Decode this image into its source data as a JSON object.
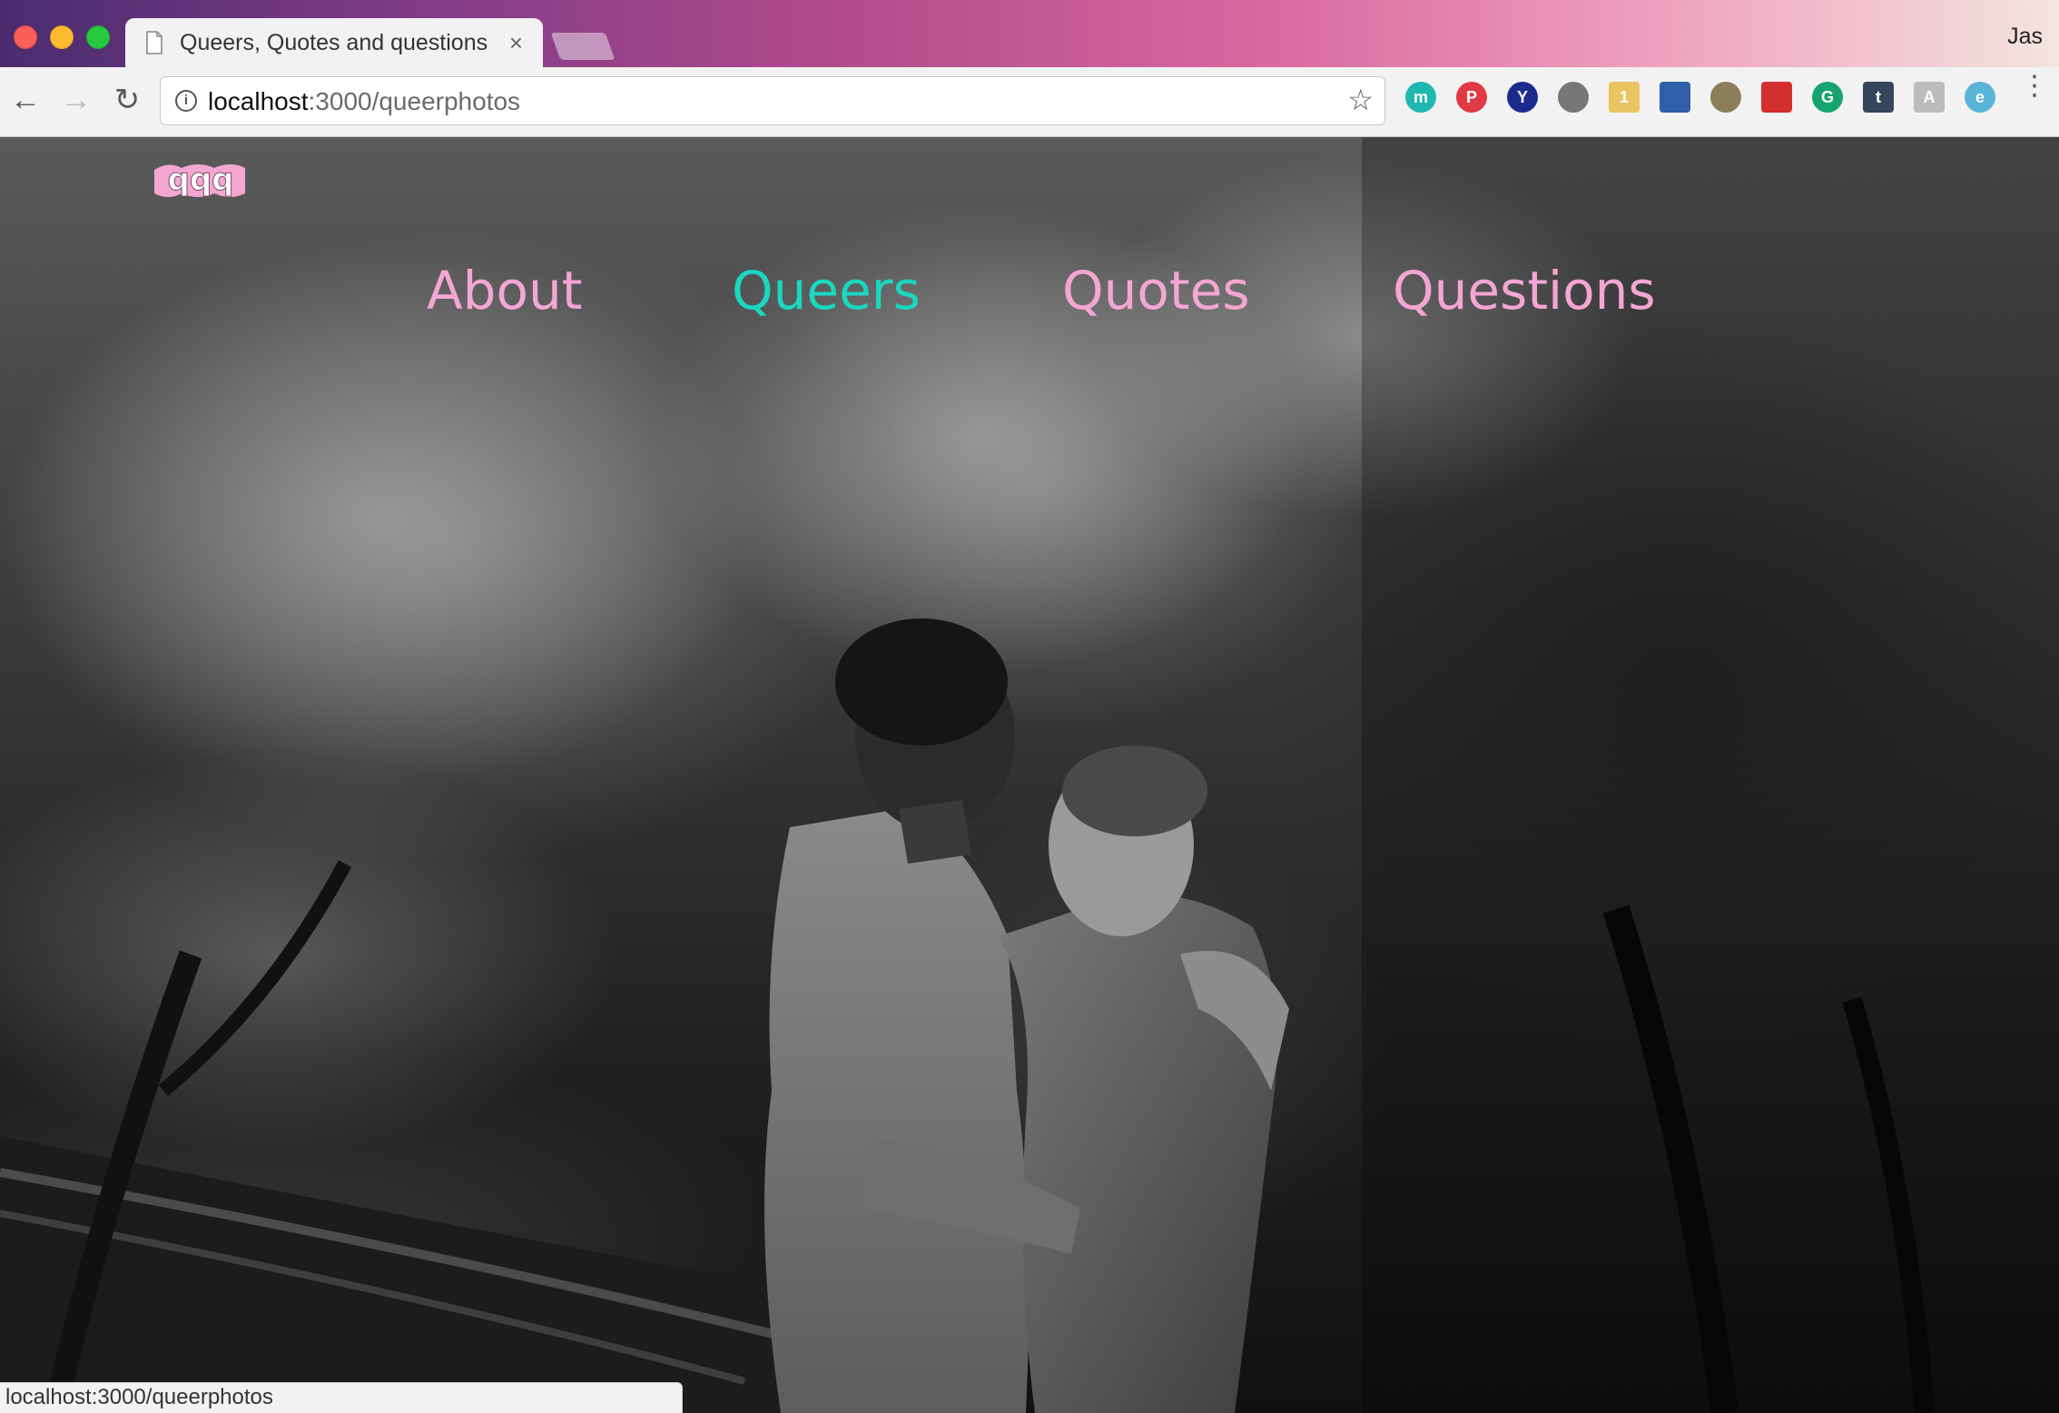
{
  "browser": {
    "tab_title": "Queers, Quotes and questions",
    "tab_close": "×",
    "profile_name": "Jas",
    "url_host": "localhost",
    "url_path": ":3000/queerphotos",
    "back_icon": "←",
    "forward_icon": "→",
    "reload_icon": "↻",
    "star_icon": "☆",
    "menu_icon": "⋮",
    "extensions": [
      {
        "name": "mendeley-icon",
        "glyph": "m",
        "color": "#1fb8b0"
      },
      {
        "name": "pinterest-icon",
        "glyph": "P",
        "color": "#e03a45"
      },
      {
        "name": "vimeo-icon",
        "glyph": "Y",
        "color": "#1a2b8c"
      },
      {
        "name": "cast-icon",
        "glyph": "",
        "color": "#777777"
      },
      {
        "name": "sticky-note-icon",
        "glyph": "1",
        "color": "#e9c460"
      },
      {
        "name": "bookmark-icon",
        "glyph": "",
        "color": "#2f5fa8"
      },
      {
        "name": "shield-icon",
        "glyph": "",
        "color": "#8a7f5a"
      },
      {
        "name": "lastpass-icon",
        "glyph": "",
        "color": "#d32f2f"
      },
      {
        "name": "grammarly-icon",
        "glyph": "G",
        "color": "#16a36f"
      },
      {
        "name": "tumblr-icon",
        "glyph": "t",
        "color": "#35465c"
      },
      {
        "name": "evernote-icon",
        "glyph": "A",
        "color": "#bcbcbc"
      },
      {
        "name": "edge-icon",
        "glyph": "e",
        "color": "#5ab4d8"
      }
    ]
  },
  "site": {
    "logo_text": "qqq",
    "nav": [
      {
        "label": "About",
        "active": false
      },
      {
        "label": "Queers",
        "active": true
      },
      {
        "label": "Quotes",
        "active": false
      },
      {
        "label": "Questions",
        "active": false
      }
    ],
    "colors": {
      "link": "#f4a6d3",
      "active_link": "#1ad7c0"
    }
  },
  "status_bar": {
    "text": "localhost:3000/queerphotos"
  }
}
